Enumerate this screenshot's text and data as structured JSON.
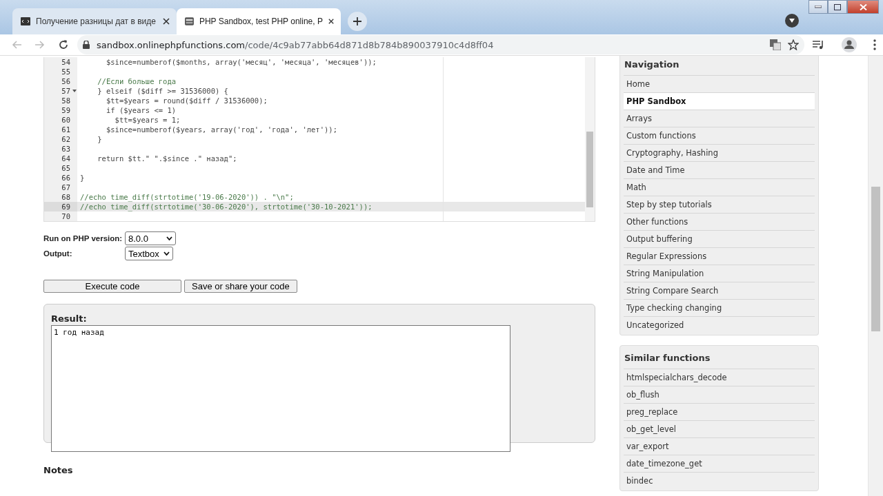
{
  "browser": {
    "tabs": [
      {
        "title": "Получение разницы дат в виде",
        "selected": false
      },
      {
        "title": "PHP Sandbox, test PHP online, P",
        "selected": true
      }
    ],
    "url": {
      "host": "sandbox.onlinephpfunctions.com",
      "path": "/code/4c9ab77abb64d871d8b784b890037910c4d8ff04"
    }
  },
  "editor": {
    "lines": [
      {
        "number": "54",
        "text": "      $since=numberof($months, array('месяц', 'месяца', 'месяцев'));",
        "kind": "code",
        "foldable": false,
        "selected": false
      },
      {
        "number": "55",
        "kind": "code",
        "foldable": false,
        "selected": false
      },
      {
        "number": "56",
        "text": "    //Если больше года",
        "kind": "comment",
        "foldable": false,
        "selected": false
      },
      {
        "number": "57",
        "text": "    } elseif ($diff >= 31536000) {",
        "kind": "code",
        "foldable": true,
        "selected": false
      },
      {
        "number": "58",
        "text": "      $tt=$years = round($diff / 31536000);",
        "kind": "code",
        "foldable": false,
        "selected": false
      },
      {
        "number": "59",
        "text": "      if ($years <= 1)",
        "kind": "code",
        "foldable": false,
        "selected": false
      },
      {
        "number": "60",
        "text": "        $tt=$years = 1;",
        "kind": "code",
        "foldable": false,
        "selected": false
      },
      {
        "number": "61",
        "text": "      $since=numberof($years, array('год', 'года', 'лет'));",
        "kind": "code",
        "foldable": false,
        "selected": false
      },
      {
        "number": "62",
        "text": "    }",
        "kind": "code",
        "foldable": false,
        "selected": false
      },
      {
        "number": "63",
        "kind": "code",
        "foldable": false,
        "selected": false
      },
      {
        "number": "64",
        "text": "    return $tt.\" \".$since .\" назад\";",
        "kind": "code",
        "foldable": false,
        "selected": false
      },
      {
        "number": "65",
        "kind": "code",
        "foldable": false,
        "selected": false
      },
      {
        "number": "66",
        "text": "}",
        "kind": "code",
        "foldable": false,
        "selected": false
      },
      {
        "number": "67",
        "kind": "code",
        "foldable": false,
        "selected": false
      },
      {
        "number": "68",
        "text": "//echo time_diff(strtotime('19-06-2020')) . \"\\n\";",
        "kind": "comment",
        "foldable": false,
        "selected": false
      },
      {
        "number": "69",
        "text": "//echo time_diff(strtotime('30-06-2020'), strtotime('30-10-2021'));",
        "kind": "comment",
        "foldable": false,
        "selected": true
      },
      {
        "number": "70",
        "kind": "code",
        "foldable": false,
        "selected": false
      }
    ]
  },
  "options": {
    "version_label": "Run on PHP version:",
    "version": "8.0.0",
    "output_label": "Output:",
    "output": "Textbox"
  },
  "buttons": [
    "Execute code",
    "Save or share your code"
  ],
  "result": {
    "title": "Result:",
    "value": "1 год назад"
  },
  "notes": {
    "title": "Notes"
  },
  "navigation": {
    "title": "Navigation",
    "items": [
      {
        "label": "Home",
        "selected": false
      },
      {
        "label": "PHP Sandbox",
        "selected": true
      },
      {
        "label": "Arrays",
        "selected": false
      },
      {
        "label": "Custom functions",
        "selected": false
      },
      {
        "label": "Cryptography, Hashing",
        "selected": false
      },
      {
        "label": "Date and Time",
        "selected": false
      },
      {
        "label": "Math",
        "selected": false
      },
      {
        "label": "Step by step tutorials",
        "selected": false
      },
      {
        "label": "Other functions",
        "selected": false
      },
      {
        "label": "Output buffering",
        "selected": false
      },
      {
        "label": "Regular Expressions",
        "selected": false
      },
      {
        "label": "String Manipulation",
        "selected": false
      },
      {
        "label": "String Compare Search",
        "selected": false
      },
      {
        "label": "Type checking changing",
        "selected": false
      },
      {
        "label": "Uncategorized",
        "selected": false
      }
    ]
  },
  "similar": {
    "title": "Similar functions",
    "items": [
      "htmlspecialchars_decode",
      "ob_flush",
      "preg_replace",
      "ob_get_level",
      "var_export",
      "date_timezone_get",
      "bindec"
    ]
  }
}
